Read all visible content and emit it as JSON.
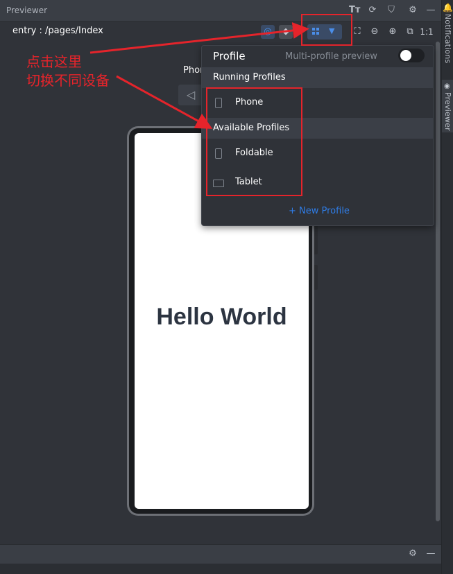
{
  "window": {
    "title": "Previewer"
  },
  "side_tabs": {
    "notifications": "Notifications",
    "previewer": "Previewer"
  },
  "toolbar": {
    "route": "entry : /pages/Index",
    "one_to_one": "1:1"
  },
  "device": {
    "label": "Phone",
    "content": "Hello World"
  },
  "profile_panel": {
    "title": "Profile",
    "multi_profile_label": "Multi-profile preview",
    "multi_profile_enabled": false,
    "running_header": "Running Profiles",
    "running": [
      {
        "name": "Phone",
        "icon": "phone-icon"
      }
    ],
    "available_header": "Available Profiles",
    "available": [
      {
        "name": "Foldable",
        "icon": "foldable-icon"
      },
      {
        "name": "Tablet",
        "icon": "tablet-icon"
      }
    ],
    "new_profile": "+ New Profile"
  },
  "annotation": {
    "line1": "点击这里",
    "line2": "切换不同设备"
  },
  "colors": {
    "accent": "#2f7ce6",
    "annotation_red": "#e5242b",
    "background": "#303339"
  }
}
